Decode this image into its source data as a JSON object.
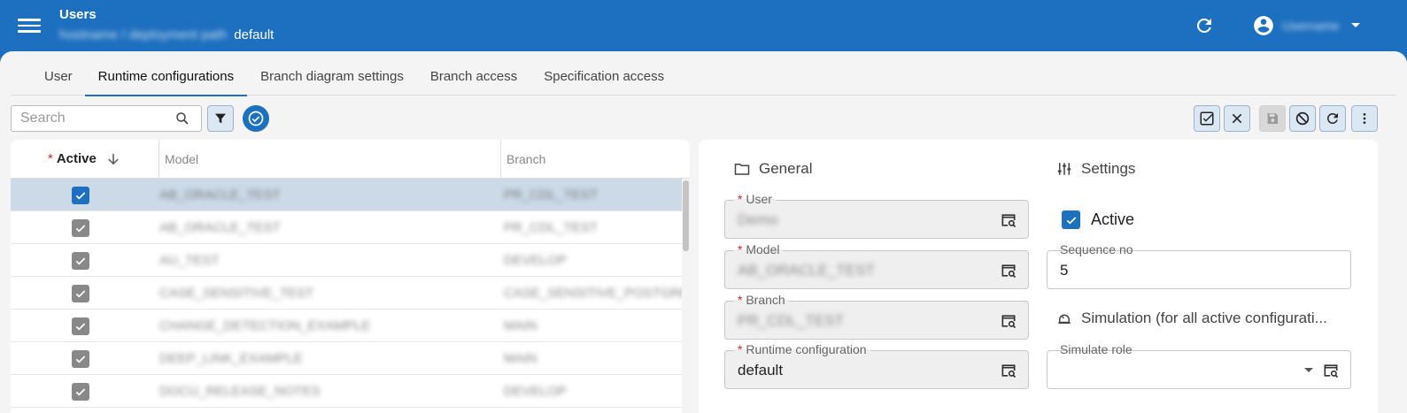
{
  "header": {
    "title": "Users",
    "subtitle_blurred": "hostname / deployment path",
    "subtitle_value": "default",
    "account_name": "Username"
  },
  "tabs": [
    {
      "label": "User",
      "active": false
    },
    {
      "label": "Runtime configurations",
      "active": true
    },
    {
      "label": "Branch diagram settings",
      "active": false
    },
    {
      "label": "Branch access",
      "active": false
    },
    {
      "label": "Specification access",
      "active": false
    }
  ],
  "toolbar": {
    "search_placeholder": "Search"
  },
  "table": {
    "columns": {
      "active": "Active",
      "model": "Model",
      "branch": "Branch"
    },
    "rows": [
      {
        "active": true,
        "model": "AB_ORACLE_TEST",
        "branch": "PR_CDL_TEST",
        "selected": true
      },
      {
        "active": true,
        "model": "AB_ORACLE_TEST",
        "branch": "PR_CDL_TEST",
        "selected": false
      },
      {
        "active": true,
        "model": "AU_TEST",
        "branch": "DEVELOP",
        "selected": false
      },
      {
        "active": true,
        "model": "CASE_SENSITIVE_TEST",
        "branch": "CASE_SENSITIVE_POSTGRES",
        "selected": false
      },
      {
        "active": true,
        "model": "CHANGE_DETECTION_EXAMPLE",
        "branch": "MAIN",
        "selected": false
      },
      {
        "active": true,
        "model": "DEEP_LINK_EXAMPLE",
        "branch": "MAIN",
        "selected": false
      },
      {
        "active": true,
        "model": "DOCU_RELEASE_NOTES",
        "branch": "DEVELOP",
        "selected": false
      }
    ]
  },
  "detail": {
    "general_title": "General",
    "settings_title": "Settings",
    "simulation_title": "Simulation (for all active configurati...",
    "user_label": "User",
    "user_value": "Demo",
    "model_label": "Model",
    "model_value": "AB_ORACLE_TEST",
    "branch_label": "Branch",
    "branch_value": "PR_CDL_TEST",
    "runtime_label": "Runtime configuration",
    "runtime_value": "default",
    "active_label": "Active",
    "sequence_label": "Sequence no",
    "sequence_value": "5",
    "simulate_role_label": "Simulate role",
    "simulate_role_value": ""
  },
  "colors": {
    "primary": "#1d6fbf",
    "required": "#c62828",
    "selected_row": "#ccd9e7"
  }
}
